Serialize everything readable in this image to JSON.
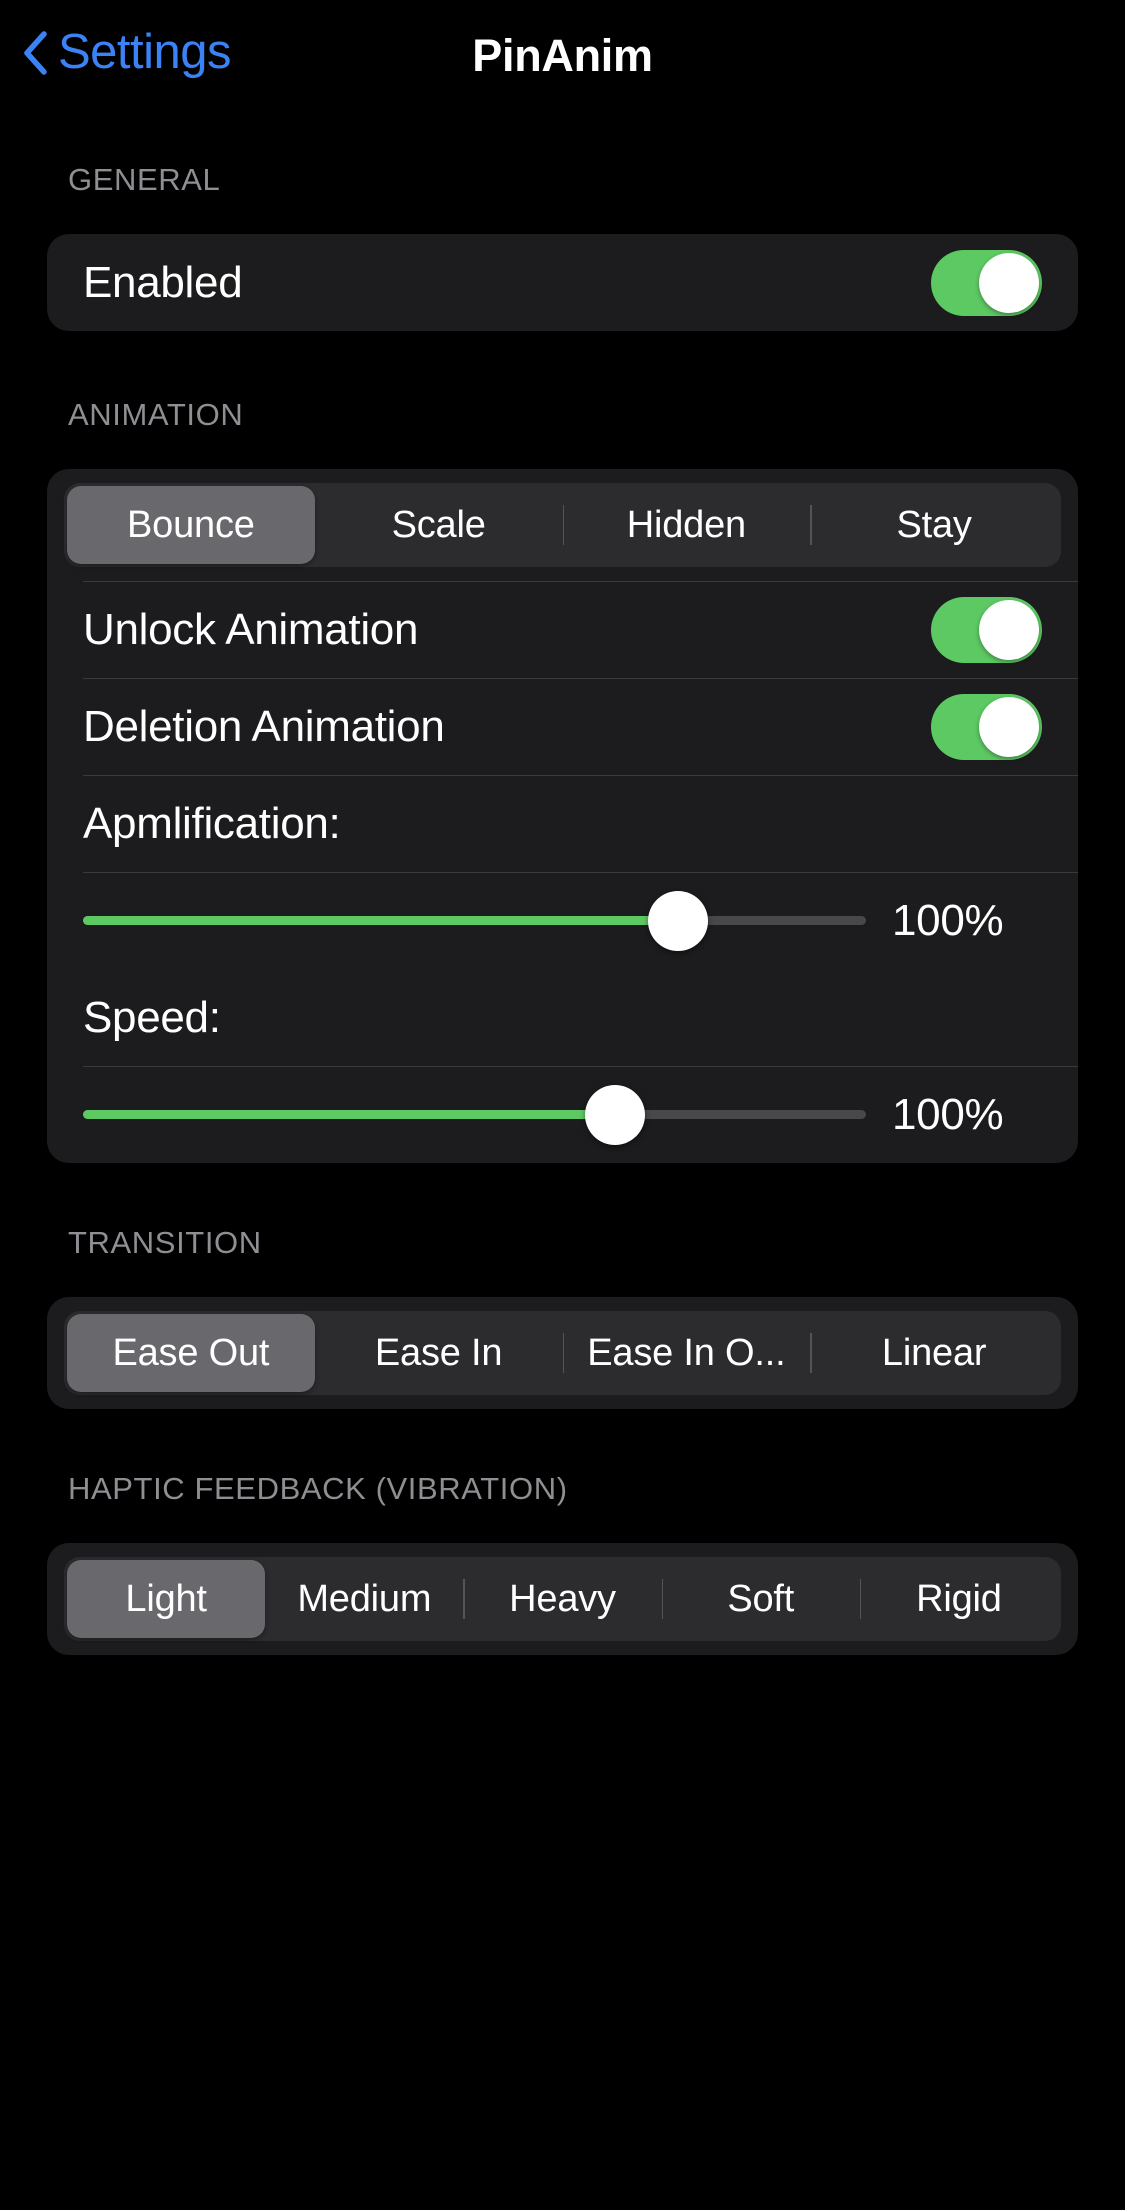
{
  "navbar": {
    "back_label": "Settings",
    "back_icon": "chevron-left-icon",
    "title": "PinAnim"
  },
  "colors": {
    "accent_green": "#5dc963",
    "link_blue": "#3b82f7",
    "card_bg": "#1c1c1e",
    "segment_track": "#2c2c2e",
    "segment_selected": "#68686d",
    "slider_track": "#48484a",
    "section_header": "#8e8e93",
    "page_bg": "#000000"
  },
  "sections": {
    "general": {
      "header": "GENERAL",
      "enabled_row": {
        "label": "Enabled",
        "toggle_state": "on"
      }
    },
    "animation": {
      "header": "ANIMATION",
      "style_segments": [
        {
          "label": "Bounce",
          "selected": true
        },
        {
          "label": "Scale",
          "selected": false
        },
        {
          "label": "Hidden",
          "selected": false
        },
        {
          "label": "Stay",
          "selected": false
        }
      ],
      "unlock_row": {
        "label": "Unlock Animation",
        "toggle_state": "on"
      },
      "deletion_row": {
        "label": "Deletion Animation",
        "toggle_state": "on"
      },
      "amplification": {
        "label": "Apmlification:",
        "value_text": "100%",
        "percent": 76
      },
      "speed": {
        "label": "Speed:",
        "value_text": "100%",
        "percent": 68
      }
    },
    "transition": {
      "header": "TRANSITION",
      "segments": [
        {
          "label": "Ease Out",
          "selected": true
        },
        {
          "label": "Ease In",
          "selected": false
        },
        {
          "label": "Ease In O...",
          "selected": false
        },
        {
          "label": "Linear",
          "selected": false
        }
      ]
    },
    "haptic": {
      "header": "HAPTIC FEEDBACK (VIBRATION)",
      "segments": [
        {
          "label": "Light",
          "selected": true
        },
        {
          "label": "Medium",
          "selected": false
        },
        {
          "label": "Heavy",
          "selected": false
        },
        {
          "label": "Soft",
          "selected": false
        },
        {
          "label": "Rigid",
          "selected": false
        }
      ]
    }
  }
}
